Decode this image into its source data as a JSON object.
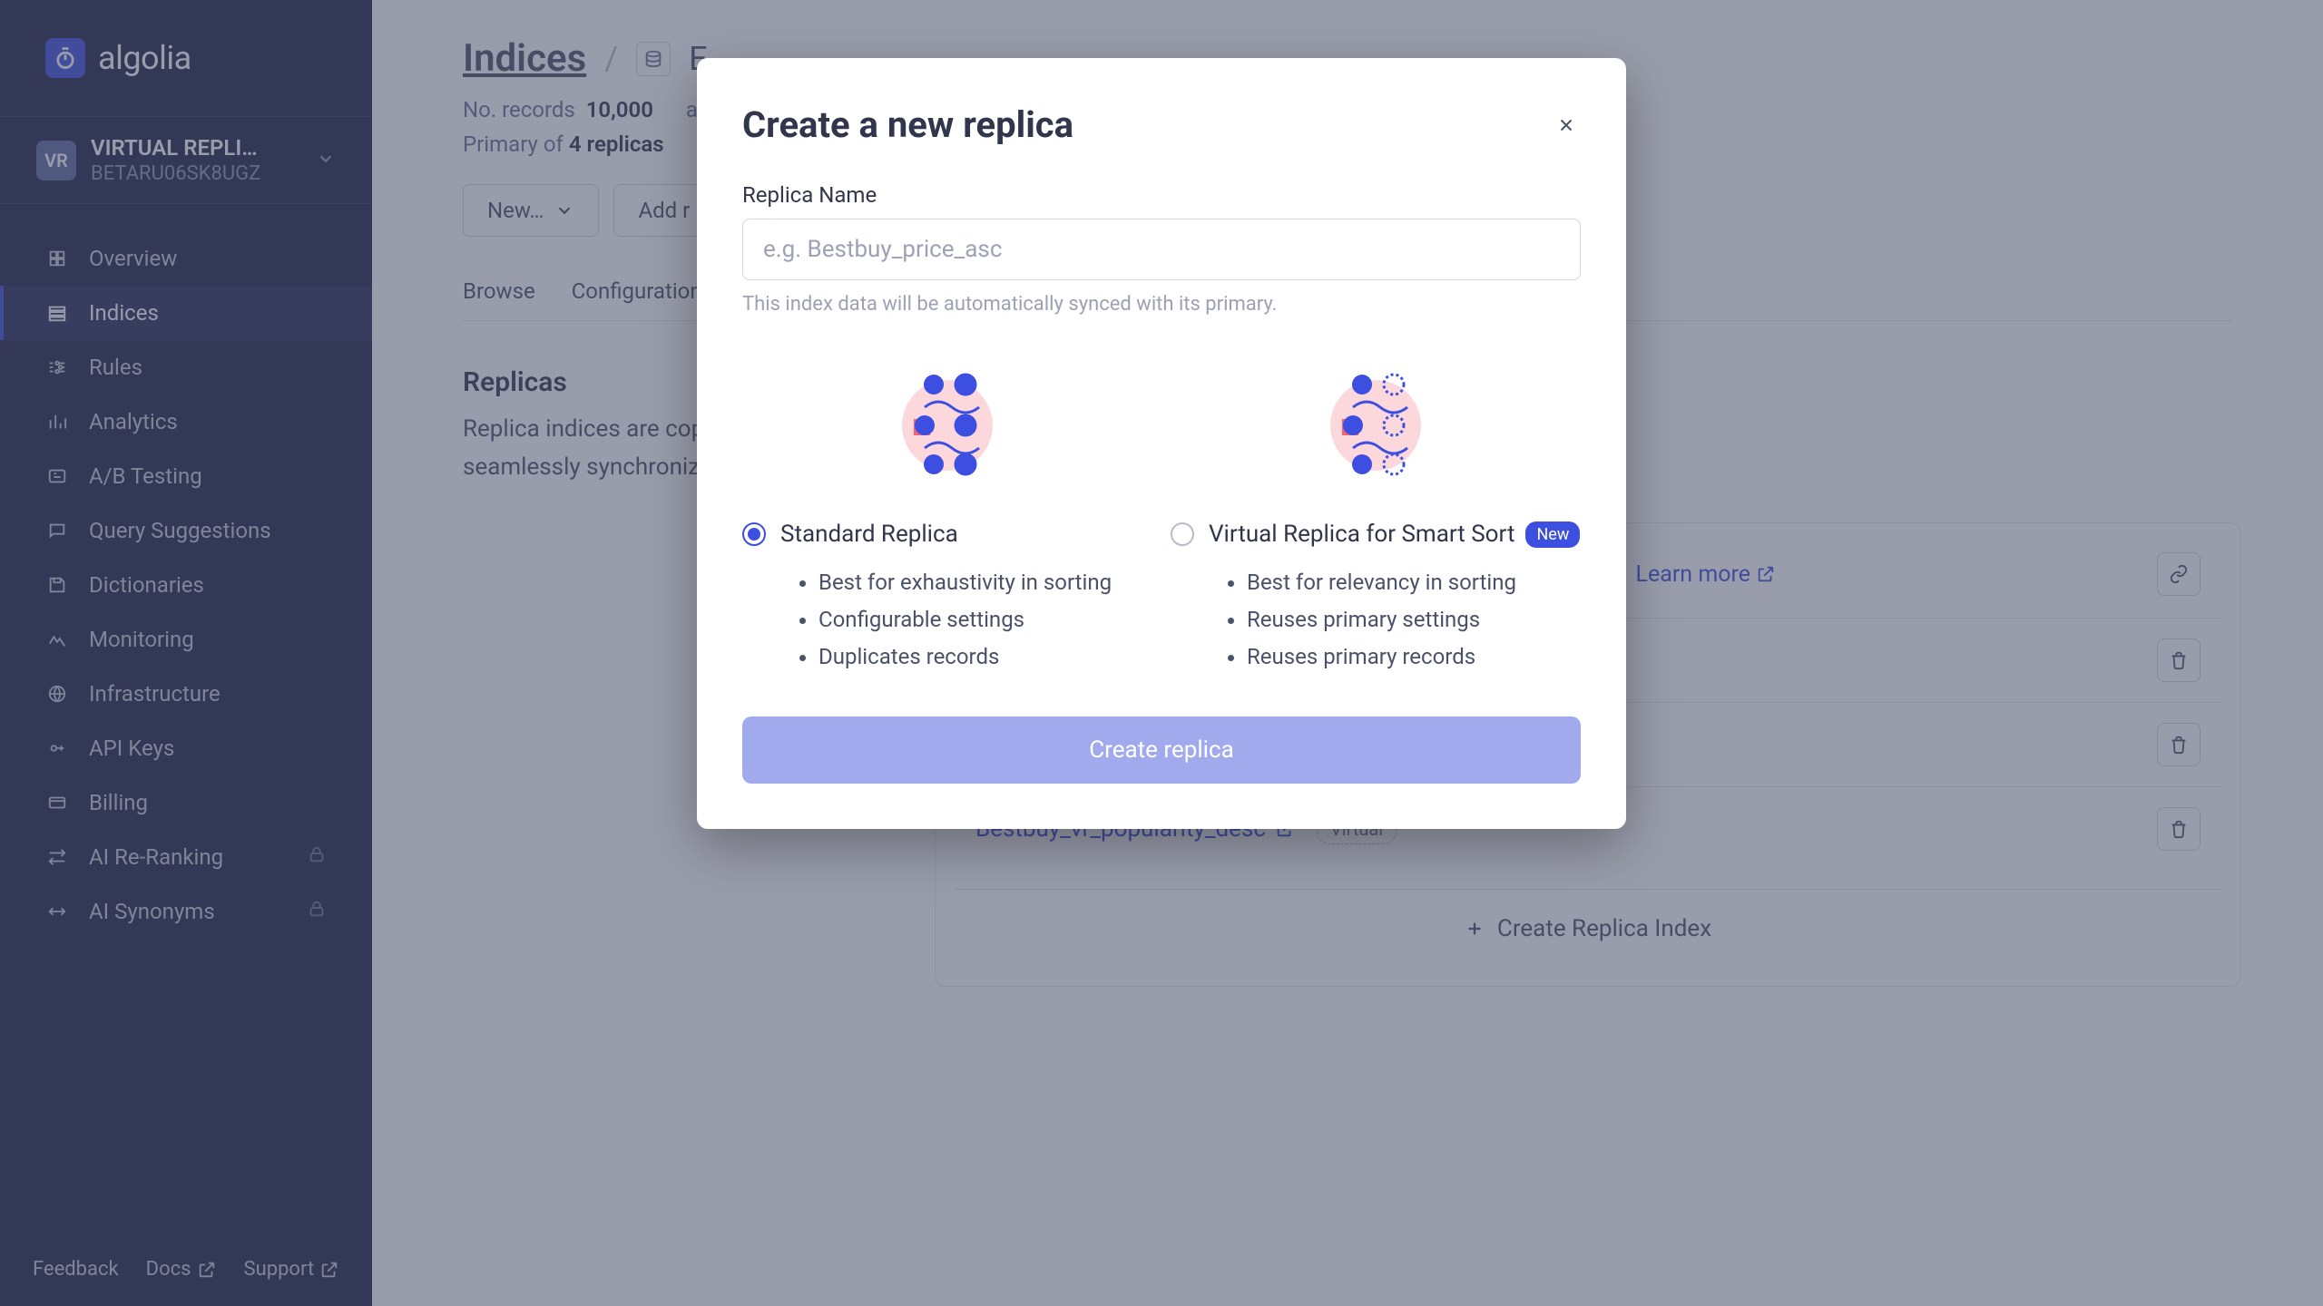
{
  "brand": "algolia",
  "workspace": {
    "badge": "VR",
    "name": "VIRTUAL REPLI…",
    "id": "BETARU06SK8UGZ"
  },
  "nav": [
    {
      "label": "Overview",
      "locked": false
    },
    {
      "label": "Indices",
      "locked": false
    },
    {
      "label": "Rules",
      "locked": false
    },
    {
      "label": "Analytics",
      "locked": false
    },
    {
      "label": "A/B Testing",
      "locked": false
    },
    {
      "label": "Query Suggestions",
      "locked": false
    },
    {
      "label": "Dictionaries",
      "locked": false
    },
    {
      "label": "Monitoring",
      "locked": false
    },
    {
      "label": "Infrastructure",
      "locked": false
    },
    {
      "label": "API Keys",
      "locked": false
    },
    {
      "label": "Billing",
      "locked": false
    },
    {
      "label": "AI Re-Ranking",
      "locked": true
    },
    {
      "label": "AI Synonyms",
      "locked": true
    }
  ],
  "active_nav_index": 1,
  "footer": {
    "feedback": "Feedback",
    "docs": "Docs",
    "support": "Support"
  },
  "breadcrumb": {
    "root": "Indices"
  },
  "stats": {
    "records_label": "No. records",
    "records_value": "10,000",
    "avg_label": "av",
    "primary_of_label": "Primary of",
    "primary_of_value": "4 replicas"
  },
  "toolbar": {
    "new_btn": "New…",
    "add_btn": "Add r"
  },
  "tabs": [
    {
      "label": "Browse"
    },
    {
      "label": "Configuration"
    }
  ],
  "replicas": {
    "heading": "Replicas",
    "description": "Replica indices are copies of a primary index (the primary index). Algolia seamlessly synchronizes replicas with their primary one.",
    "learn_more": "Learn more",
    "card_title": "",
    "items": [
      {
        "name": "",
        "virtual": false
      },
      {
        "name": "",
        "virtual": false
      },
      {
        "name": "Bestbuy_vr_popularity_desc",
        "virtual": true
      }
    ],
    "virtual_badge": "Virtual",
    "create_btn": "Create Replica Index"
  },
  "modal": {
    "title": "Create a new replica",
    "input_label": "Replica Name",
    "input_placeholder": "e.g. Bestbuy_price_asc",
    "input_help": "This index data will be automatically synced with its primary.",
    "options": [
      {
        "title": "Standard Replica",
        "badge": null,
        "selected": true,
        "bullets": [
          "Best for exhaustivity in sorting",
          "Configurable settings",
          "Duplicates records"
        ]
      },
      {
        "title": "Virtual Replica for Smart Sort",
        "badge": "New",
        "selected": false,
        "bullets": [
          "Best for relevancy in sorting",
          "Reuses primary settings",
          "Reuses primary records"
        ]
      }
    ],
    "submit": "Create replica"
  }
}
